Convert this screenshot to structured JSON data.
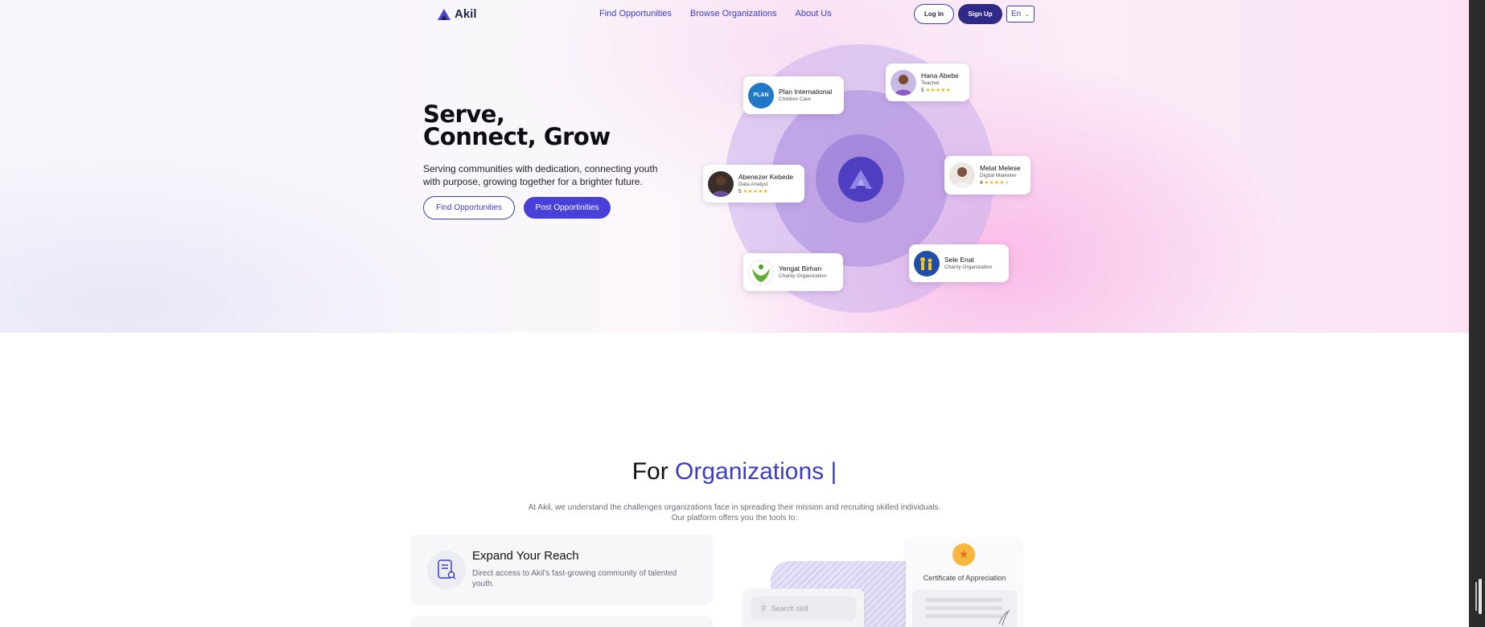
{
  "brand": {
    "name": "Akil",
    "color": "#3b3ec5",
    "dark": "#2f2a88"
  },
  "nav": {
    "links": [
      "Find Opportunities",
      "Browse Organizations",
      "About Us"
    ],
    "login_label": "Log In",
    "signup_label": "Sign Up",
    "language": "En"
  },
  "hero": {
    "title_line1": "Serve,",
    "title_line2": "Connect, Grow",
    "subtitle": "Serving communities with dedication, connecting youth with purpose, growing together for a brighter future.",
    "find_button": "Find Opportunities",
    "post_button": "Post Opportinities"
  },
  "orbit_cards": {
    "plan": {
      "name": "Plan International",
      "role": "Children Care",
      "logo_text": "PLAN"
    },
    "hana": {
      "name": "Hana Abebe",
      "role": "Teacher",
      "rating": "5",
      "stars": "★★★★★"
    },
    "abenezer": {
      "name": "Abenezer Kebede",
      "role": "Data Analyst",
      "rating": "5",
      "stars": "★★★★★"
    },
    "melat": {
      "name": "Melat Melese",
      "role": "Digital Marketer",
      "rating": "4",
      "stars": "★★★★",
      "stars_off": "★"
    },
    "yengat": {
      "name": "Yengat Birhan",
      "role": "Charity Organization"
    },
    "sele": {
      "name": "Sele Enat",
      "role": "Charity Organization"
    }
  },
  "organizations": {
    "title_prefix": "For",
    "title_accent": "Organizations",
    "caret": "|",
    "desc_line1": "At Akil, we understand the challenges organizations face in spreading their mission and recruiting skilled individuals.",
    "desc_line2": "Our platform offers you the tools to:",
    "feature": {
      "title": "Expand Your Reach",
      "desc": "Direct access to Akil's fast-growing community of talented youth."
    },
    "illustration": {
      "search_placeholder": "Search skill",
      "certificate_title": "Certificate of Appreciation"
    }
  }
}
